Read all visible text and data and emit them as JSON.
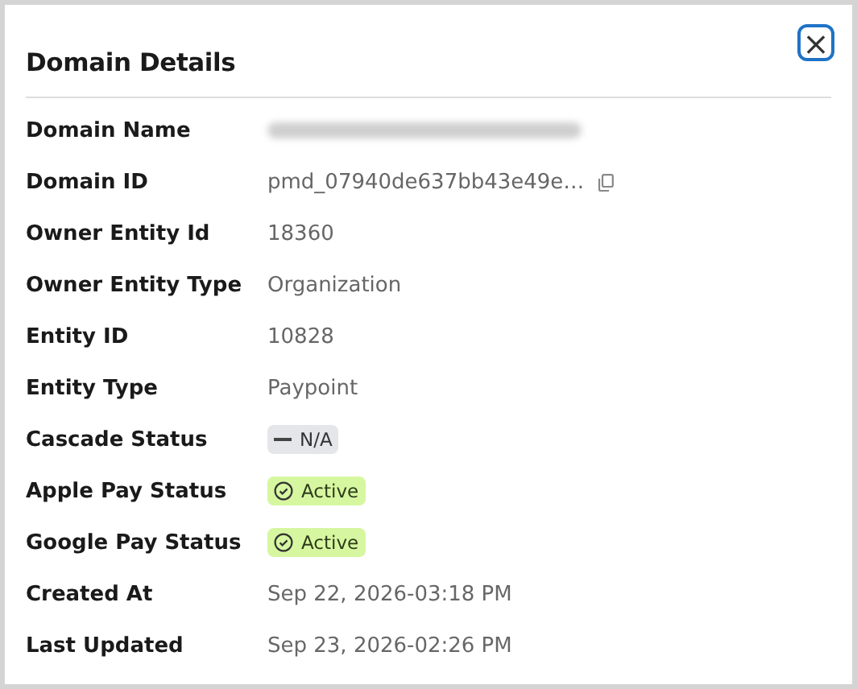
{
  "dialog": {
    "title": "Domain Details",
    "close_icon": "×"
  },
  "fields": [
    {
      "label": "Domain Name",
      "kind": "redacted"
    },
    {
      "label": "Domain ID",
      "kind": "copy",
      "value": "pmd_07940de637bb43e49e…"
    },
    {
      "label": "Owner Entity Id",
      "kind": "text",
      "value": "18360"
    },
    {
      "label": "Owner Entity Type",
      "kind": "text",
      "value": "Organization"
    },
    {
      "label": "Entity ID",
      "kind": "text",
      "value": "10828"
    },
    {
      "label": "Entity Type",
      "kind": "text",
      "value": "Paypoint"
    },
    {
      "label": "Cascade Status",
      "kind": "neutral",
      "color": "#e4e6ea",
      "value": "N/A"
    },
    {
      "label": "Apple Pay Status",
      "kind": "success",
      "color": "#d6f7a0",
      "value": "Active"
    },
    {
      "label": "Google Pay Status",
      "kind": "success",
      "color": "#d6f7a0",
      "value": "Active"
    },
    {
      "label": "Created At",
      "kind": "text",
      "value": "Sep 22, 2026-03:18 PM"
    },
    {
      "label": "Last Updated",
      "kind": "text",
      "value": "Sep 23, 2026-02:26 PM"
    }
  ]
}
